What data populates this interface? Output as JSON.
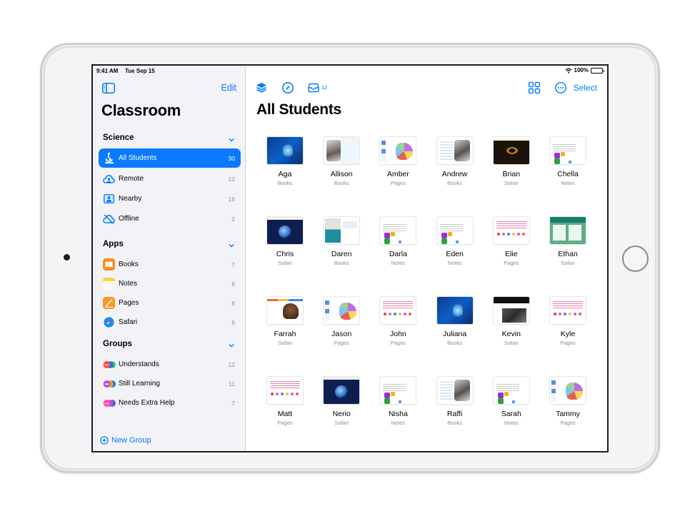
{
  "status_bar": {
    "time": "9:41 AM",
    "date": "Tue  Sep 15",
    "battery": "100%"
  },
  "sidebar": {
    "edit_label": "Edit",
    "title": "Classroom",
    "sections": [
      {
        "header": "Science",
        "items": [
          {
            "label": "All Students",
            "count": "30",
            "icon": "microscope-icon",
            "selected": true
          },
          {
            "label": "Remote",
            "count": "12",
            "icon": "cloud-person-icon"
          },
          {
            "label": "Nearby",
            "count": "16",
            "icon": "person-square-icon"
          },
          {
            "label": "Offline",
            "count": "2",
            "icon": "cloud-slash-icon"
          }
        ]
      },
      {
        "header": "Apps",
        "items": [
          {
            "label": "Books",
            "count": "7",
            "icon": "books-app-icon"
          },
          {
            "label": "Notes",
            "count": "6",
            "icon": "notes-app-icon"
          },
          {
            "label": "Pages",
            "count": "8",
            "icon": "pages-app-icon"
          },
          {
            "label": "Safari",
            "count": "6",
            "icon": "safari-app-icon"
          }
        ]
      },
      {
        "header": "Groups",
        "items": [
          {
            "label": "Understands",
            "count": "12",
            "icon": "group-avatars-icon",
            "initials": "BC"
          },
          {
            "label": "Still Learning",
            "count": "11",
            "icon": "group-avatars-icon",
            "initials": "MR"
          },
          {
            "label": "Needs Extra Help",
            "count": "7",
            "icon": "group-avatars-icon",
            "initials": "AC"
          }
        ]
      }
    ],
    "new_group_label": "New Group"
  },
  "toolbar": {
    "inbox_count": "12",
    "select_label": "Select",
    "icons": [
      "layers-icon",
      "compass-icon",
      "inbox-icon",
      "grid-icon",
      "more-icon"
    ]
  },
  "main": {
    "title": "All Students",
    "students": [
      {
        "name": "Aga",
        "app": "Books",
        "thumb": "books-ocean"
      },
      {
        "name": "Allison",
        "app": "Books",
        "thumb": "books-bird"
      },
      {
        "name": "Amber",
        "app": "Pages",
        "thumb": "pages-map"
      },
      {
        "name": "Andrew",
        "app": "Books",
        "thumb": "books-hawk"
      },
      {
        "name": "Brian",
        "app": "Safari",
        "thumb": "safari-space"
      },
      {
        "name": "Chella",
        "app": "Notes",
        "thumb": "notes"
      },
      {
        "name": "Chris",
        "app": "Safari",
        "thumb": "safari-earth"
      },
      {
        "name": "Daren",
        "app": "Books",
        "thumb": "books-fish"
      },
      {
        "name": "Darla",
        "app": "Notes",
        "thumb": "notes"
      },
      {
        "name": "Eden",
        "app": "Notes",
        "thumb": "notes"
      },
      {
        "name": "Elie",
        "app": "Pages",
        "thumb": "pages-pink"
      },
      {
        "name": "Ethan",
        "app": "Safari",
        "thumb": "safari-green"
      },
      {
        "name": "Farrah",
        "app": "Safari",
        "thumb": "safari-mammoth"
      },
      {
        "name": "Jason",
        "app": "Pages",
        "thumb": "pages-map"
      },
      {
        "name": "John",
        "app": "Pages",
        "thumb": "pages-pink"
      },
      {
        "name": "Juliana",
        "app": "Books",
        "thumb": "books-ocean"
      },
      {
        "name": "Kevin",
        "app": "Safari",
        "thumb": "safari-bw"
      },
      {
        "name": "Kyle",
        "app": "Pages",
        "thumb": "pages-pink"
      },
      {
        "name": "Matt",
        "app": "Pages",
        "thumb": "pages-pink"
      },
      {
        "name": "Nerio",
        "app": "Safari",
        "thumb": "safari-earth"
      },
      {
        "name": "Nisha",
        "app": "Notes",
        "thumb": "notes"
      },
      {
        "name": "Raffi",
        "app": "Books",
        "thumb": "books-hawk"
      },
      {
        "name": "Sarah",
        "app": "Notes",
        "thumb": "notes"
      },
      {
        "name": "Tammy",
        "app": "Pages",
        "thumb": "pages-map"
      }
    ]
  },
  "colors": {
    "accent": "#007aff",
    "selected_row": "#0a7aff",
    "sidebar_bg": "#f2f2f7",
    "secondary_text": "#8e8e93"
  }
}
